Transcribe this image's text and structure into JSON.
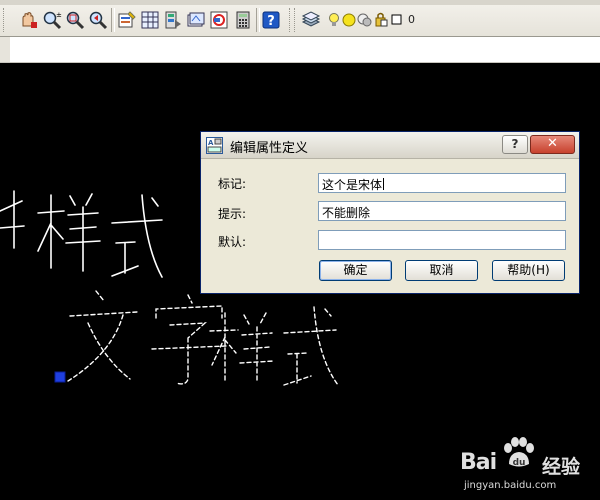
{
  "toolbar": {
    "icons": [
      "pan-realtime-icon",
      "zoom-realtime-icon",
      "zoom-window-icon",
      "zoom-previous-icon",
      "properties-icon",
      "design-center-icon",
      "tool-palettes-icon",
      "sheet-set-icon",
      "markup-icon",
      "calculator-icon",
      "help-icon"
    ],
    "layer_combo_value": "0"
  },
  "canvas_text": {
    "solid_text": "字样式",
    "dashed_text": "文字样式"
  },
  "dialog": {
    "title": "编辑属性定义",
    "help_button": "?",
    "close_button": "✕",
    "fields": [
      {
        "label": "标记:",
        "value": "这个是宋体"
      },
      {
        "label": "提示:",
        "value": "不能删除"
      },
      {
        "label": "默认:",
        "value": ""
      }
    ],
    "buttons": {
      "ok": "确定",
      "cancel": "取消",
      "help": "帮助(H)"
    }
  },
  "watermark": {
    "brand": "Bai",
    "product": "经验",
    "url": "jingyan.baidu.com"
  },
  "colors": {
    "canvas_bg": "#000000",
    "drawing_line": "#ffffff",
    "grip": "#1f3fe0",
    "dialog_bg": "#ece9d8",
    "close_red": "#c7412d"
  }
}
